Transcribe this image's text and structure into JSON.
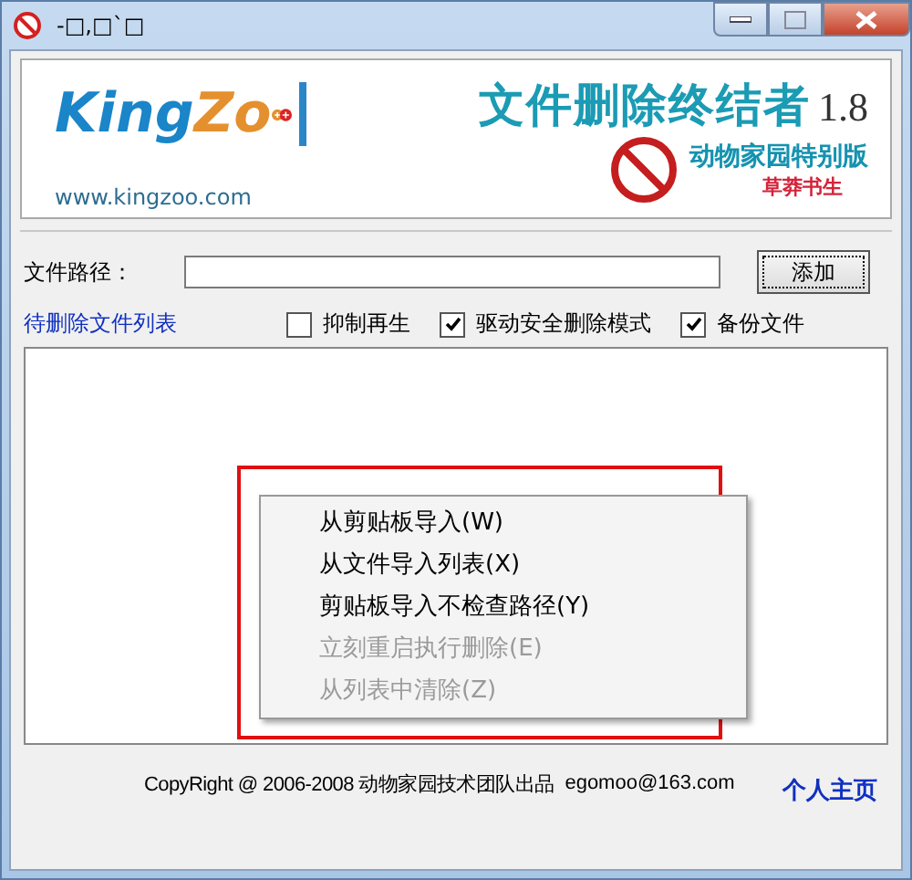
{
  "window": {
    "title": "-□,□`□"
  },
  "banner": {
    "logo_main": "King",
    "logo_accent": "Zo",
    "url": "www.kingzoo.com",
    "title": "文件删除终结者",
    "version": "1.8",
    "edition": "动物家园特别版",
    "author": "草莽书生"
  },
  "path": {
    "label": "文件路径：",
    "button": "添加"
  },
  "list": {
    "label": "待删除文件列表",
    "options": [
      {
        "label": "抑制再生",
        "checked": false
      },
      {
        "label": "驱动安全删除模式",
        "checked": true
      },
      {
        "label": "备份文件",
        "checked": true
      }
    ]
  },
  "context_menu": {
    "items": [
      {
        "label": "从剪贴板导入(W)",
        "disabled": false
      },
      {
        "label": "从文件导入列表(X)",
        "disabled": false
      },
      {
        "label": "剪贴板导入不检查路径(Y)",
        "disabled": false
      },
      {
        "label": "立刻重启执行删除(E)",
        "disabled": true
      },
      {
        "label": "从列表中清除(Z)",
        "disabled": true
      }
    ]
  },
  "footer": {
    "copyright": "CopyRight @ 2006-2008 动物家园技术团队出品",
    "email": "egomoo@163.com",
    "link": "个人主页"
  }
}
